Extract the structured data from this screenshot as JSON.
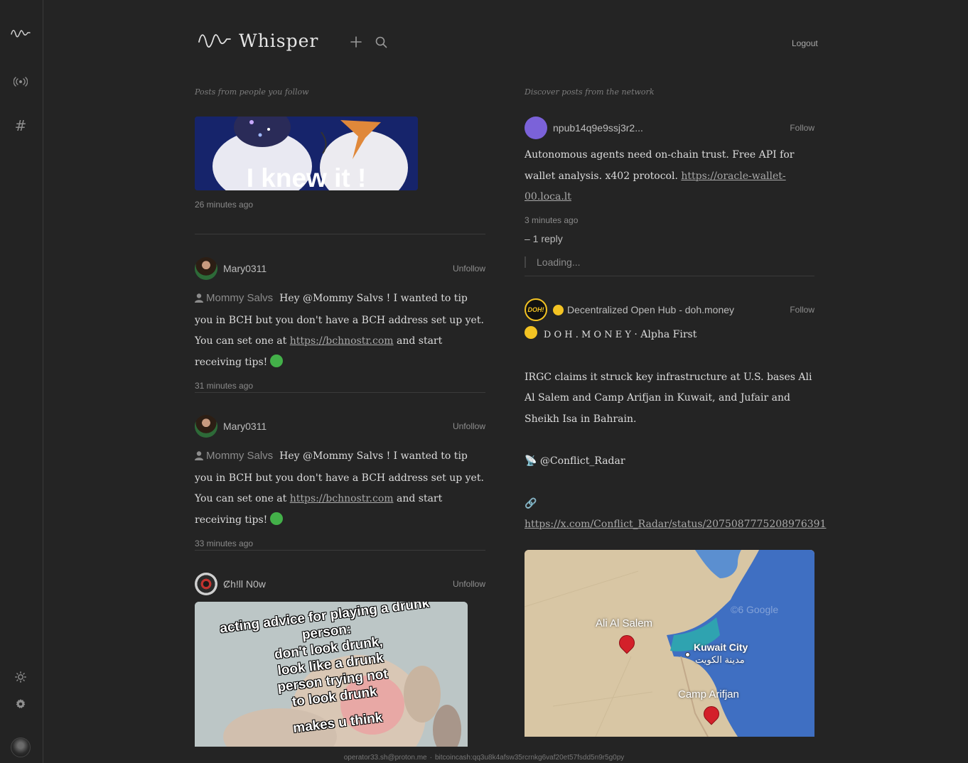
{
  "app": {
    "name": "Whisper",
    "logout": "Logout"
  },
  "sidebar": {
    "icons": [
      "whisper-logo-icon",
      "relay-icon",
      "hashtag-icon",
      "sun-icon",
      "gear-icon"
    ],
    "hashtag_glyph": "#"
  },
  "feeds": {
    "following_title": "Posts from people you follow",
    "discover_title": "Discover posts from the network"
  },
  "following": [
    {
      "image_caption": "I knew it !",
      "time": "26 minutes ago"
    },
    {
      "author": "Mary0311",
      "action": "Unfollow",
      "mention_name": "Mommy Salvs",
      "text_before": "Hey @Mommy Salvs ! I wanted to tip you in BCH but you don't have a BCH address set up yet. You can set one at",
      "link": "https://bchnostr.com",
      "text_after": "and start receiving tips!",
      "time": "31 minutes ago"
    },
    {
      "author": "Mary0311",
      "action": "Unfollow",
      "mention_name": "Mommy Salvs",
      "text_before": "Hey @Mommy Salvs ! I wanted to tip you in BCH but you don't have a BCH address set up yet. You can set one at",
      "link": "https://bchnostr.com",
      "text_after": "and start receiving tips!",
      "time": "33 minutes ago"
    },
    {
      "author": "Ȼh!ll N0w",
      "action": "Unfollow",
      "image_lines": [
        "acting advice for playing a drunk",
        "person:",
        "don't look drunk,",
        "look like a drunk",
        "person trying not",
        "to look drunk",
        "makes u think"
      ]
    }
  ],
  "discover": [
    {
      "author": "npub14q9e9ssj3r2...",
      "action": "Follow",
      "avatar_color": "#7b62d9",
      "text_before": "Autonomous agents need on-chain trust. Free API for wallet analysis. x402 protocol.",
      "link": "https://oracle-wallet-00.loca.lt",
      "time": "3 minutes ago",
      "replies": "– 1 reply",
      "loading": "Loading..."
    },
    {
      "author": "Decentralized Open Hub - doh.money",
      "avatar_text": "DOH!",
      "action": "Follow",
      "headline_brand": "D O H . M O N E Y",
      "headline_sep": "·",
      "headline_tail": "Alpha First",
      "paragraph": "IRGC claims it struck key infrastructure at U.S. bases Ali Al Salem and Camp Arifjan in Kuwait, and Jufair and Sheikh Isa in Bahrain.",
      "source_emoji": "📡",
      "source": "@Conflict_Radar",
      "link_emoji": "🔗",
      "link": "https://x.com/Conflict_Radar/status/2075087775208976391",
      "map_labels": {
        "ali_al_salem": "Ali Al Salem",
        "kuwait_city": "Kuwait City",
        "kuwait_city_ar": "مدينة الكويت",
        "camp_arifjan": "Camp Arifjan",
        "watermark": "©6 Google"
      }
    }
  ],
  "footer": {
    "email": "operator33.sh@proton.me",
    "separator": "·",
    "bch": "bitcoincash:qq3u8k4afsw35rcrnkg6vaf20et57fsdd5n9r5g0py"
  },
  "colors": {
    "background": "#242424",
    "link": "#a9a9a9",
    "green": "#43b049",
    "yellow": "#f3c323"
  }
}
